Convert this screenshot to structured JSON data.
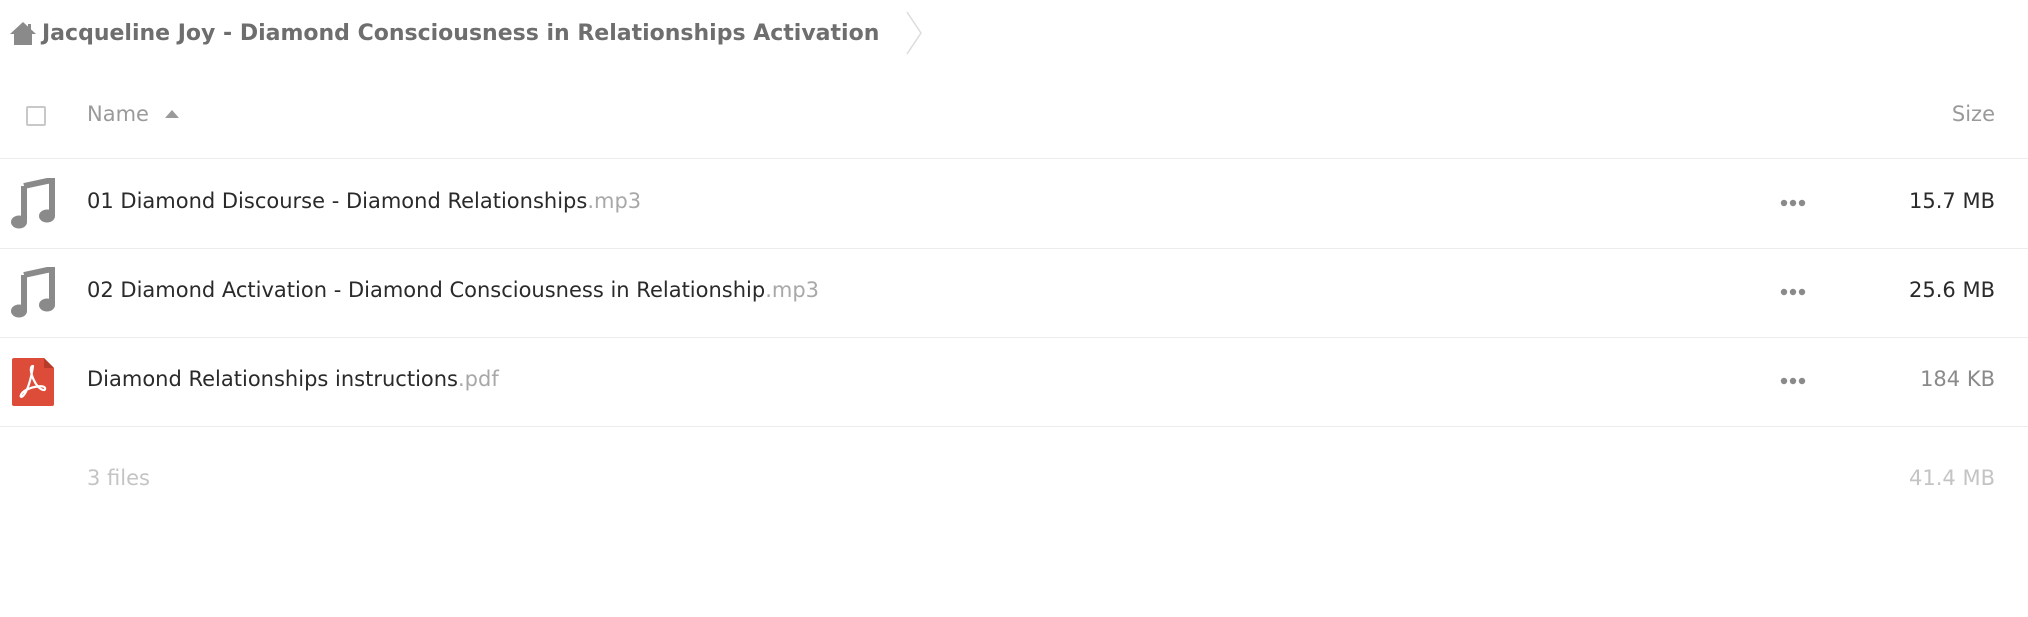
{
  "breadcrumb": {
    "home_icon": "home-icon",
    "title": "Jacqueline Joy - Diamond Consciousness in Relationships Activation"
  },
  "header": {
    "name_label": "Name",
    "size_label": "Size",
    "sort_icon": "sort-ascending-icon"
  },
  "files": [
    {
      "basename": "01 Diamond Discourse - Diamond Relationships",
      "ext": ".mp3",
      "size": "15.7 MB",
      "icon": "audio-file-icon"
    },
    {
      "basename": "02 Diamond Activation - Diamond Consciousness in Relationship",
      "ext": ".mp3",
      "size": "25.6 MB",
      "icon": "audio-file-icon"
    },
    {
      "basename": "Diamond Relationships instructions",
      "ext": ".pdf",
      "size": "184 KB",
      "icon": "pdf-file-icon"
    }
  ],
  "summary": {
    "count": "3 files",
    "total_size": "41.4 MB"
  },
  "colors": {
    "icon_gray": "#8a8a8a",
    "pdf_red": "#dd4b39",
    "text_muted": "#9a9a9a"
  }
}
